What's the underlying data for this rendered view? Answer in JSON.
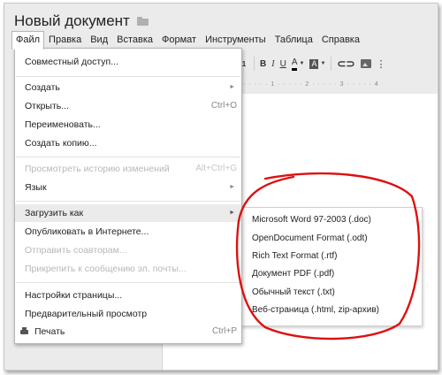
{
  "document": {
    "title": "Новый документ",
    "folder_icon": "folder-icon"
  },
  "menubar": {
    "items": [
      "Файл",
      "Правка",
      "Вид",
      "Вставка",
      "Формат",
      "Инструменты",
      "Таблица",
      "Справка"
    ],
    "active": "Файл"
  },
  "toolbar": {
    "font_size": "11",
    "bold": "B",
    "italic": "I",
    "underline": "U",
    "text_color": "A",
    "highlight": "A",
    "caret": "▼",
    "link_icon": "link-icon",
    "image_icon": "image-icon",
    "more": "⋮"
  },
  "ruler": {
    "marks": "1 · · · · · 1 · · · · · 2 · · · · · 3 · · · · · 4"
  },
  "file_menu": {
    "share": "Совместный доступ...",
    "create": "Создать",
    "open": "Открыть...",
    "open_shortcut": "Ctrl+O",
    "rename": "Переименовать...",
    "copy": "Создать копию...",
    "history": "Просмотреть историю изменений",
    "history_shortcut": "Alt+Ctrl+G",
    "language": "Язык",
    "download": "Загрузить как",
    "publish": "Опубликовать в Интернете...",
    "email_collab": "Отправить соавторам...",
    "attach": "Прикрепить к сообщению эл. почты...",
    "page_setup": "Настройки страницы...",
    "preview": "Предварительный просмотр",
    "print": "Печать",
    "print_shortcut": "Ctrl+P",
    "submenu_arrow": "►"
  },
  "download_submenu": {
    "items": [
      "Microsoft Word 97-2003 (.doc)",
      "OpenDocument Format (.odt)",
      "Rich Text Format (.rtf)",
      "Документ PDF (.pdf)",
      "Обычный текст (.txt)",
      "Веб-страница (.html, zip-архив)"
    ]
  },
  "colors": {
    "annotation": "#dd1111",
    "hover": "#ebebeb",
    "disabled_text": "#b8b8b8"
  }
}
